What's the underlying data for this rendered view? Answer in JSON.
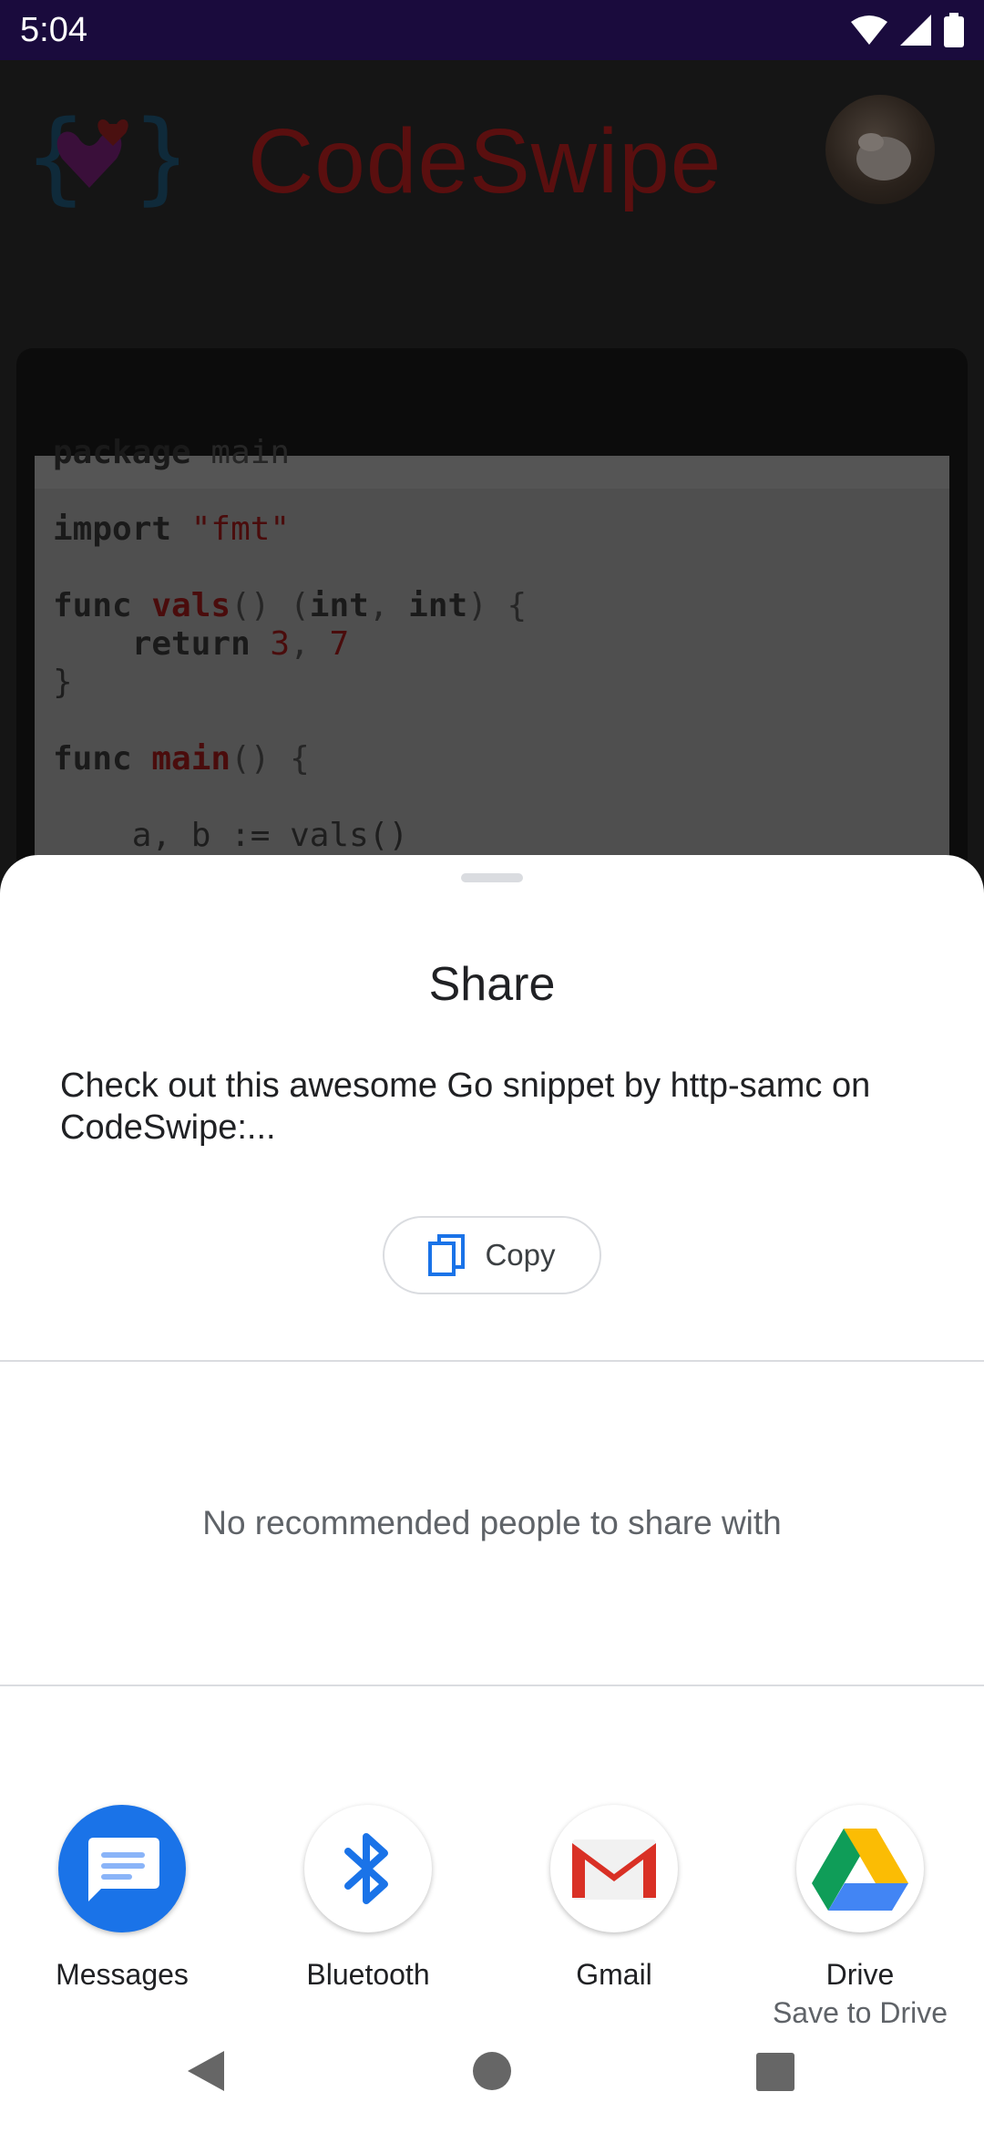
{
  "status_bar": {
    "time": "5:04"
  },
  "background_app": {
    "title": "CodeSwipe",
    "code": {
      "l1": {
        "kw": "package",
        "rest": " main"
      },
      "l2": {
        "kw": "import",
        "str": " \"fmt\""
      },
      "l3": {
        "kw": "func",
        "fn": " vals",
        "a": "() (",
        "t1": "int",
        "b": ", ",
        "t2": "int",
        "c": ") {"
      },
      "l4": {
        "indent": "    ",
        "kw": "return",
        "n1": " 3",
        "sep": ", ",
        "n2": "7"
      },
      "l5": {
        "text": "}"
      },
      "l6": {
        "kw": "func",
        "fn": " main",
        "rest": "() {"
      },
      "l7": {
        "text": "    a, b := vals()"
      }
    }
  },
  "share_sheet": {
    "title": "Share",
    "text": "Check out this awesome Go snippet by http-samc on CodeSwipe:...",
    "copy_label": "Copy",
    "no_people": "No recommended people to share with",
    "targets": [
      {
        "label": "Messages",
        "icon": "messages-icon",
        "color": "#1a73e8"
      },
      {
        "label": "Bluetooth",
        "icon": "bluetooth-icon",
        "color": "#1a73e8"
      },
      {
        "label": "Gmail",
        "icon": "gmail-icon",
        "color": "#d93025"
      },
      {
        "label": "Drive",
        "sublabel": "Save to Drive",
        "icon": "drive-icon"
      }
    ]
  },
  "nav": {
    "back": "back-icon",
    "home": "home-icon",
    "recents": "recents-icon"
  }
}
